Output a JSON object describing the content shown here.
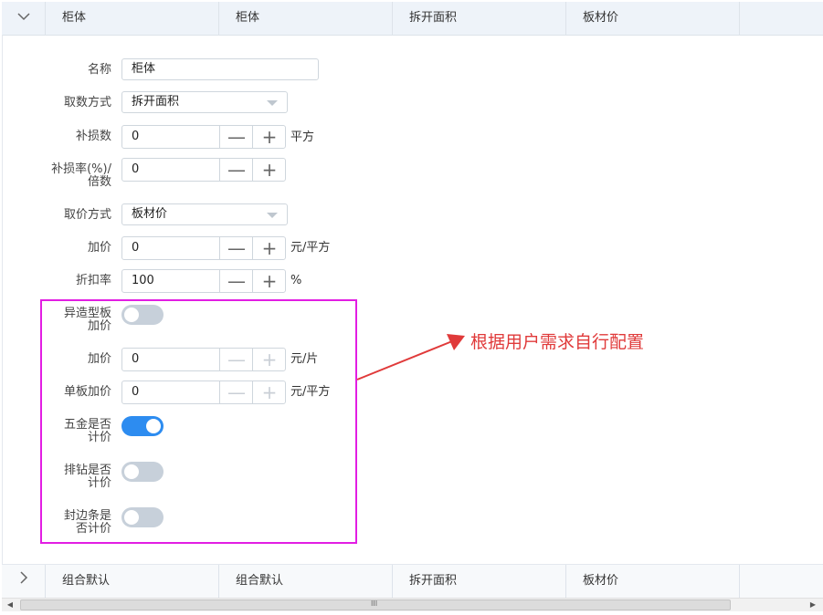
{
  "header": {
    "toggle_icon": "chevron-down-icon",
    "cells": [
      "柜体",
      "柜体",
      "拆开面积",
      "板材价"
    ]
  },
  "form": {
    "name": {
      "label": "名称",
      "value": "柜体"
    },
    "quantity_method": {
      "label": "取数方式",
      "value": "拆开面积"
    },
    "loss_amount": {
      "label": "补损数",
      "value": "0",
      "unit": "平方"
    },
    "loss_rate": {
      "label_line1": "补损率(%)/",
      "label_line2": "倍数",
      "value": "0"
    },
    "price_method": {
      "label": "取价方式",
      "value": "板材价"
    },
    "markup": {
      "label": "加价",
      "value": "0",
      "unit": "元/平方"
    },
    "discount": {
      "label": "折扣率",
      "value": "100",
      "unit": "%"
    },
    "special_board_markup": {
      "label_line1": "异造型板",
      "label_line2": "加价",
      "on": false
    },
    "piece_markup": {
      "label": "加价",
      "value": "0",
      "unit": "元/片"
    },
    "single_board_markup": {
      "label": "单板加价",
      "value": "0",
      "unit": "元/平方"
    },
    "hardware_pricing": {
      "label_line1": "五金是否",
      "label_line2": "计价",
      "on": true
    },
    "drilling_pricing": {
      "label_line1": "排钻是否",
      "label_line2": "计价",
      "on": false
    },
    "edge_pricing": {
      "label_line1": "封边条是",
      "label_line2": "否计价",
      "on": false
    },
    "minus_symbol": "—",
    "plus_symbol": "+"
  },
  "annotation": {
    "text": "根据用户需求自行配置",
    "color": "#e03a3a",
    "box_color": "#e21ee3"
  },
  "footer_row": {
    "toggle_icon": "chevron-right-icon",
    "cells": [
      "组合默认",
      "组合默认",
      "拆开面积",
      "板材价"
    ]
  },
  "scrollbar": {
    "grip": "III"
  },
  "colors": {
    "switch_on": "#2d8cf0",
    "switch_off": "#c7d0da"
  }
}
